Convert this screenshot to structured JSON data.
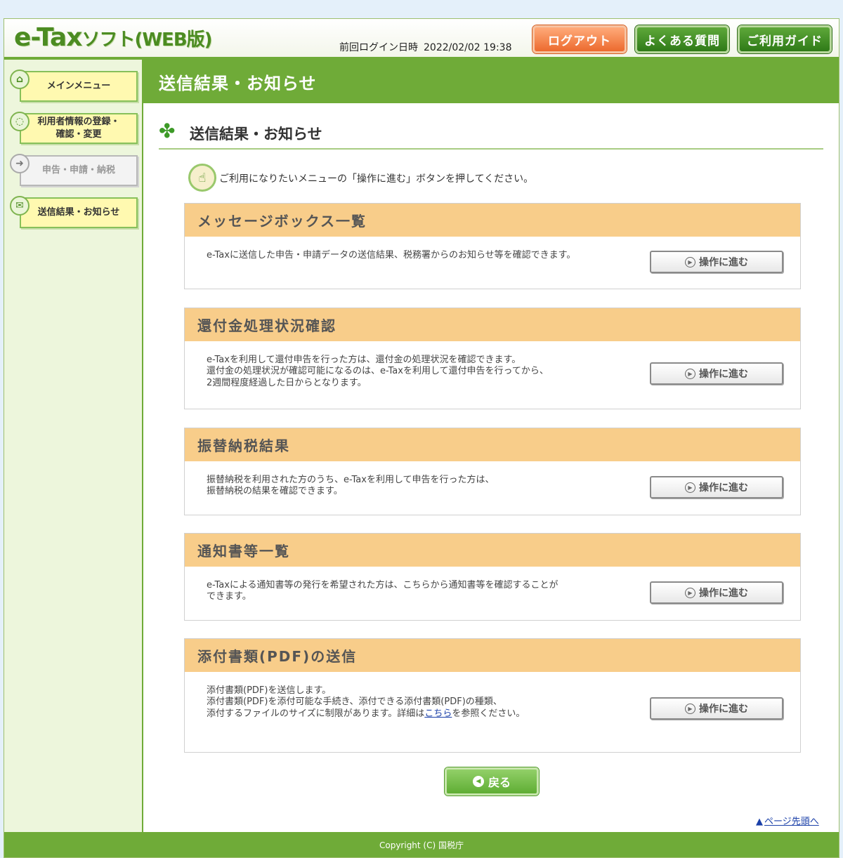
{
  "header": {
    "logo_main": "e-Tax",
    "logo_sub": "ソフト(WEB版)",
    "last_login_label": "前回ログイン日時",
    "last_login_value": "2022/02/02 19:38",
    "logout_label": "ログアウト",
    "faq_label": "よくある質問",
    "guide_label": "ご利用ガイド"
  },
  "sidebar": {
    "items": [
      {
        "label": "メインメニュー"
      },
      {
        "label": "利用者情報の登録・\n確認・変更"
      },
      {
        "label": "申告・申請・納税"
      },
      {
        "label": "送信結果・お知らせ"
      }
    ]
  },
  "main": {
    "title": "送信結果・お知らせ",
    "subtitle": "送信結果・お知らせ",
    "instruction": "ご利用になりたいメニューの「操作に進む」ボタンを押してください。",
    "go_label": "操作に進む",
    "sections": [
      {
        "title": "メッセージボックス一覧",
        "desc": "e-Taxに送信した申告・申請データの送信結果、税務署からのお知らせ等を確認できます。"
      },
      {
        "title": "還付金処理状況確認",
        "desc": "e-Taxを利用して還付申告を行った方は、還付金の処理状況を確認できます。\n還付金の処理状況が確認可能になるのは、e-Taxを利用して還付申告を行ってから、\n2週間程度経過した日からとなります。"
      },
      {
        "title": "振替納税結果",
        "desc": "振替納税を利用された方のうち、e-Taxを利用して申告を行った方は、\n振替納税の結果を確認できます。"
      },
      {
        "title": "通知書等一覧",
        "desc": "e-Taxによる通知書等の発行を希望された方は、こちらから通知書等を確認することが\nできます。"
      },
      {
        "title": "添付書類(PDF)の送信",
        "desc_line1": "添付書類(PDF)を送信します。",
        "desc_line2": "添付書類(PDF)を添付可能な手続き、添付できる添付書類(PDF)の種類、",
        "desc_line3_pre": "添付するファイルのサイズに制限があります。詳細は",
        "desc_link": "こちら",
        "desc_line3_post": "を参照ください。"
      }
    ],
    "back_label": "戻る",
    "page_top_label": "ページ先頭へ"
  },
  "footer": {
    "copyright": "Copyright (C) 国税庁"
  },
  "colors": {
    "header_green": "#6fab38",
    "section_header": "#f8cd8a",
    "logout_orange": "#ec6a2e",
    "sidebar_bg": "#edf6dc"
  },
  "icons": [
    "home-icon",
    "user-icon",
    "arrow-icon",
    "mail-icon",
    "clover-icon",
    "play-icon",
    "back-icon",
    "up-arrow-icon"
  ]
}
